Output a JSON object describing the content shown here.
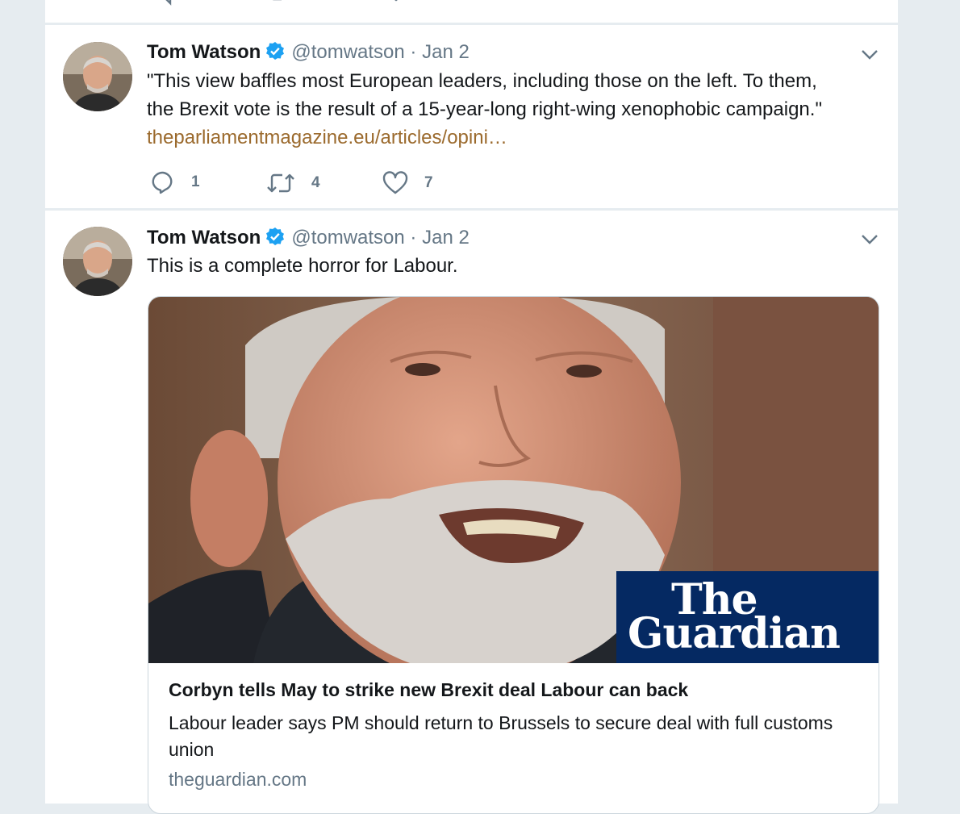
{
  "colors": {
    "verified": "#1da1f2",
    "link": "#9b6a2d",
    "guardian_blue": "#052962"
  },
  "tweets": [
    {
      "author": "Tom Watson",
      "handle": "@tomwatson",
      "separator": "·",
      "date": "Jan 2",
      "text_lines": [
        "\"This view baffles most European leaders, including those on the left. To them,",
        "the Brexit vote is the result of a 15-year-long right-wing xenophobic campaign.\""
      ],
      "link": "theparliamentmagazine.eu/articles/opini…",
      "replies": "1",
      "retweets": "4",
      "likes": "7"
    },
    {
      "author": "Tom Watson",
      "handle": "@tomwatson",
      "separator": "·",
      "date": "Jan 2",
      "text": "This is a complete horror for Labour.",
      "card": {
        "logo_line1": "The",
        "logo_line2": "Guardian",
        "title": "Corbyn tells May to strike new Brexit deal Labour can back",
        "description": "Labour leader says PM should return to Brussels to secure deal with full customs union",
        "domain": "theguardian.com"
      }
    }
  ]
}
